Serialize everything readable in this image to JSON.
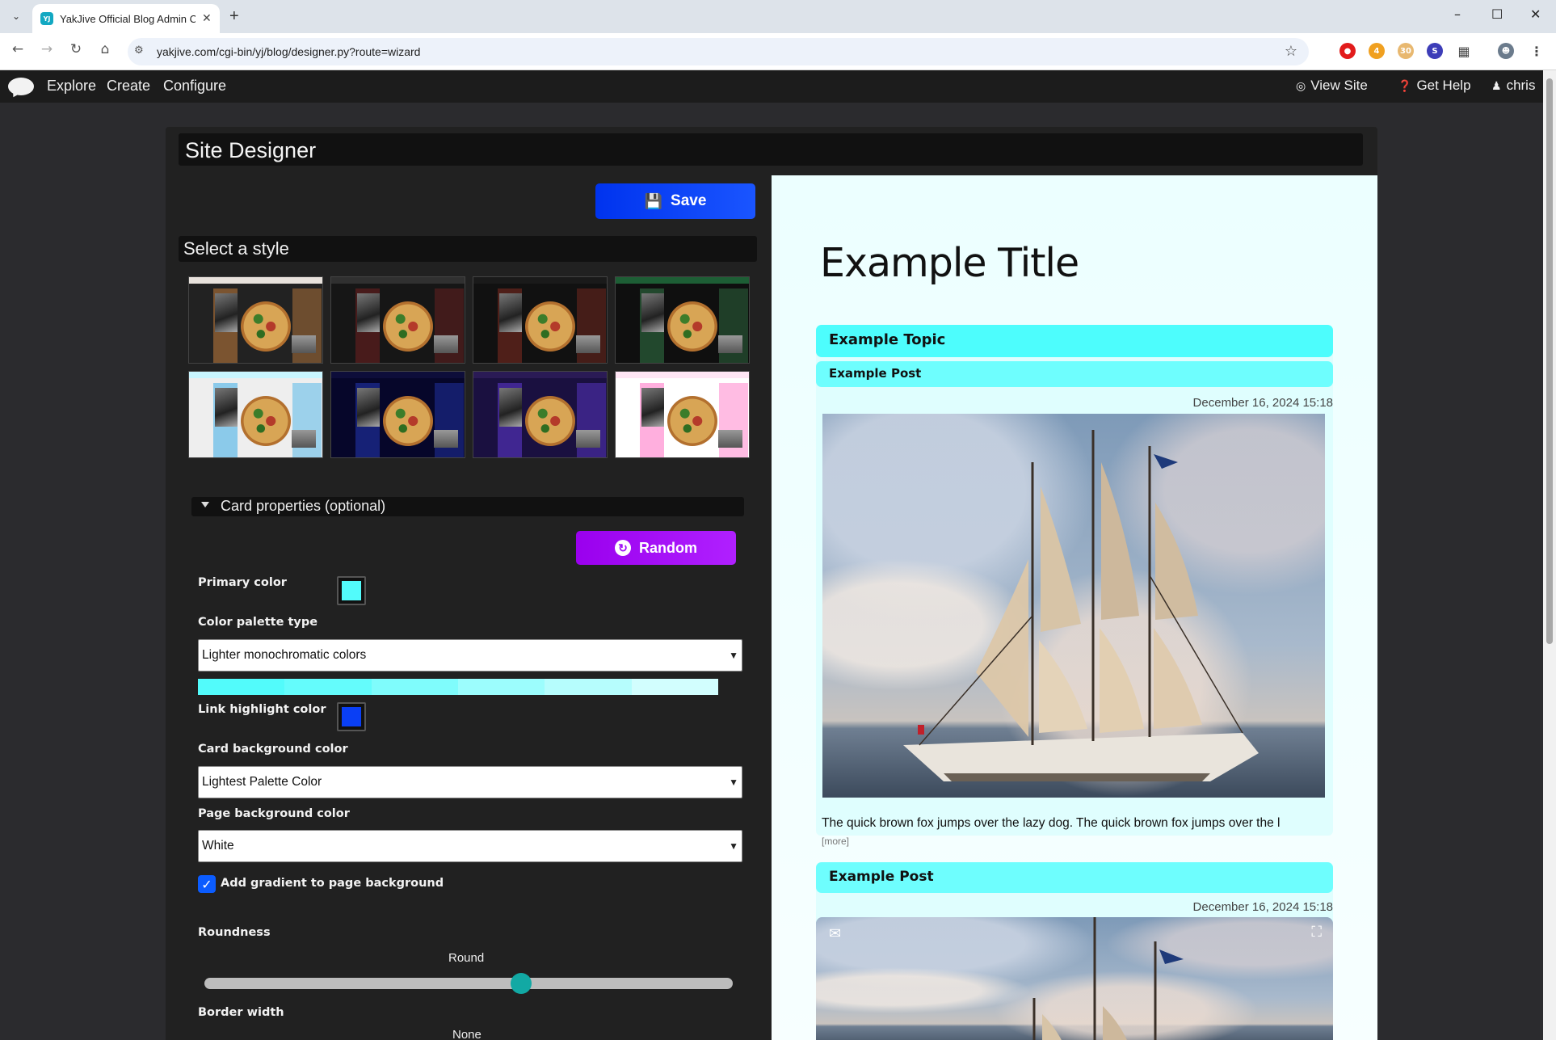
{
  "browser": {
    "tab_title": "YakJive Official Blog Admin Con",
    "url": "yakjive.com/cgi-bin/yj/blog/designer.py?route=wizard",
    "extension_badges": [
      "4",
      "30"
    ]
  },
  "appbar": {
    "nav": [
      "Explore",
      "Create",
      "Configure"
    ],
    "view_site": "View Site",
    "get_help": "Get Help",
    "user": "chris"
  },
  "designer": {
    "title": "Site Designer",
    "save_label": "Save",
    "style_section": "Select a style",
    "styles": [
      {
        "top": "#e8e2dc",
        "side": "#222",
        "col": "#b8773b"
      },
      {
        "top": "#303030",
        "side": "#161616",
        "col": "#6b1f1f"
      },
      {
        "top": "#1a1a1a",
        "side": "#111",
        "col": "#7a2a20"
      },
      {
        "top": "#1d5e35",
        "side": "#0f0f0f",
        "col": "#2f6e41"
      },
      {
        "top": "#c9f6ff",
        "side": "#eeeeee",
        "col": "#4ab3e8"
      },
      {
        "top": "#0d0d3a",
        "side": "#06062a",
        "col": "#2233aa"
      },
      {
        "top": "#2a1a55",
        "side": "#1a1040",
        "col": "#5a35c8"
      },
      {
        "top": "#ffe6f5",
        "side": "#ffffff",
        "col": "#ff7ac8"
      }
    ],
    "card_section": "Card properties (optional)",
    "random_label": "Random",
    "primary_color_label": "Primary color",
    "primary_color": "#52fbfb",
    "palette_type_label": "Color palette type",
    "palette_type_value": "Lighter monochromatic colors",
    "palette": [
      "#52fbfb",
      "#64fcfc",
      "#7ffcfc",
      "#9cfdfd",
      "#b6fdfd",
      "#d2fefe"
    ],
    "link_color_label": "Link highlight color",
    "link_color": "#0a3ff5",
    "card_bg_label": "Card background color",
    "card_bg_value": "Lightest Palette Color",
    "page_bg_label": "Page background color",
    "page_bg_value": "White",
    "gradient_label": "Add gradient to page background",
    "gradient_checked": true,
    "roundness_label": "Roundness",
    "roundness_value": "Round",
    "roundness_level": 0.6,
    "border_label": "Border width",
    "border_value": "None"
  },
  "preview": {
    "title": "Example Title",
    "topic": "Example Topic",
    "post1": "Example Post",
    "date1": "December 16, 2024 15:18",
    "excerpt": "The quick brown fox jumps over the lazy dog. The quick brown fox jumps over the l",
    "more": "[more]",
    "post2": "Example Post",
    "date2": "December 16, 2024 15:18"
  }
}
